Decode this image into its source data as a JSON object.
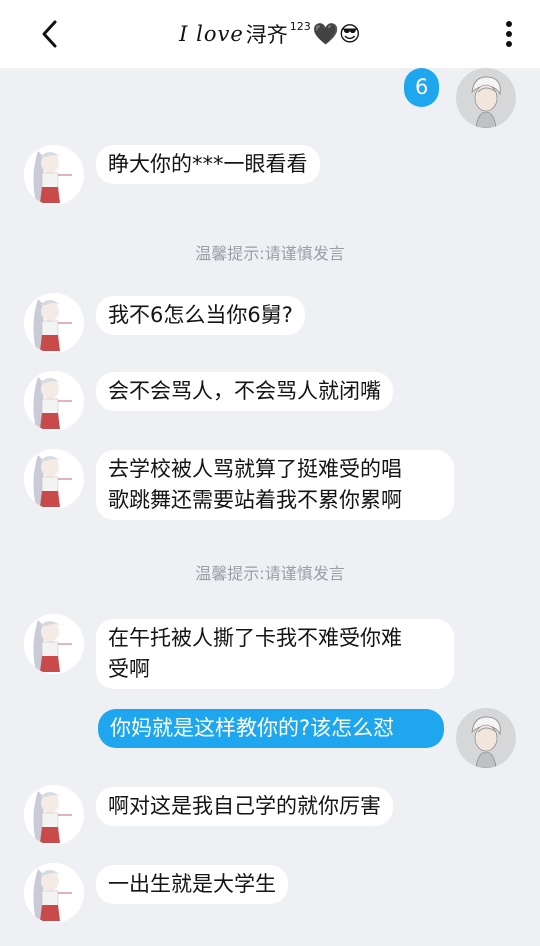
{
  "header": {
    "title_script": "I love",
    "title_name": "浔齐",
    "title_sup": "123",
    "title_emoji": "🖤😎"
  },
  "messages": [
    {
      "sender": "me",
      "text": "6"
    },
    {
      "sender": "other",
      "text": "睁大你的***一眼看看"
    },
    {
      "type": "tip",
      "text": "温馨提示:请谨慎发言"
    },
    {
      "sender": "other",
      "text": "我不6怎么当你6舅?"
    },
    {
      "sender": "other",
      "text": "会不会骂人，不会骂人就闭嘴"
    },
    {
      "sender": "other",
      "text": "去学校被人骂就算了挺难受的唱\n歌跳舞还需要站着我不累你累啊"
    },
    {
      "type": "tip",
      "text": "温馨提示:请谨慎发言"
    },
    {
      "sender": "other",
      "text": "在午托被人撕了卡我不难受你难\n受啊"
    },
    {
      "sender": "me",
      "text": "你妈就是这样教你的?该怎么怼"
    },
    {
      "sender": "other",
      "text": "啊对这是我自己学的就你厉害"
    },
    {
      "sender": "other",
      "text": "一出生就是大学生"
    }
  ]
}
